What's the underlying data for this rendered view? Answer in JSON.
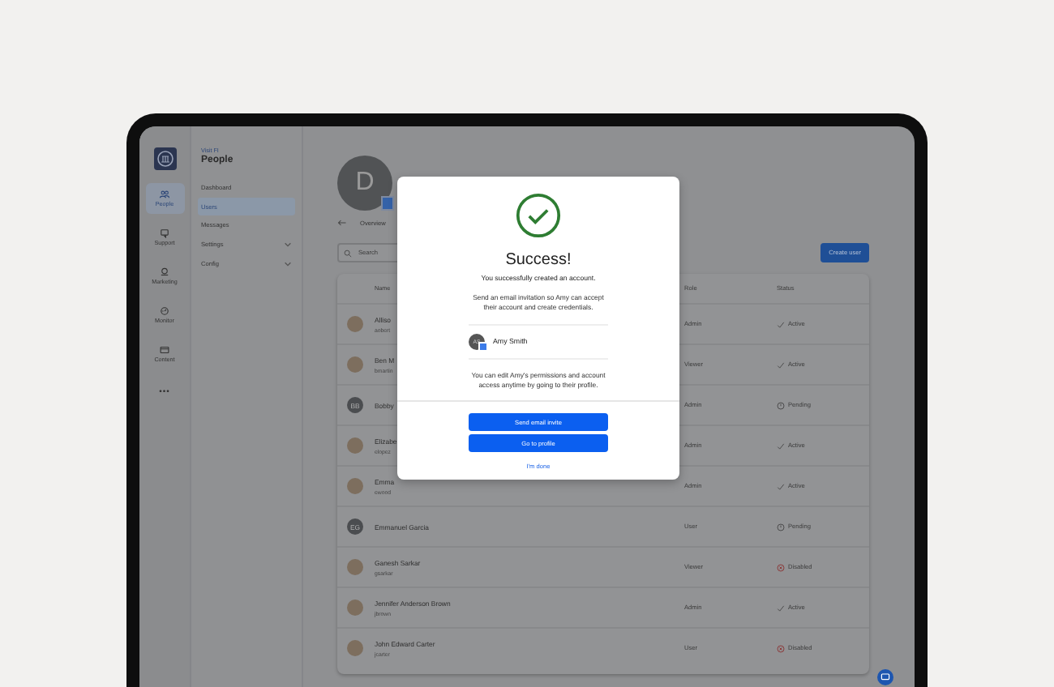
{
  "rail": [
    {
      "label": "People",
      "selected": true,
      "kind": "people"
    },
    {
      "label": "Support",
      "selected": false,
      "kind": "support"
    },
    {
      "label": "Marketing",
      "selected": false,
      "kind": "marketing"
    },
    {
      "label": "Monitor",
      "selected": false,
      "kind": "monitor"
    },
    {
      "label": "Content",
      "selected": false,
      "kind": "content"
    }
  ],
  "rail_more": "•••",
  "sidebar": {
    "eyebrow": "Visit FI",
    "title": "People",
    "items": [
      {
        "label": "Dashboard",
        "selected": false,
        "expandable": false
      },
      {
        "label": "Users",
        "selected": true,
        "expandable": false
      },
      {
        "label": "Messages",
        "selected": false,
        "expandable": false
      },
      {
        "label": "Settings",
        "selected": false,
        "expandable": true
      },
      {
        "label": "Config",
        "selected": false,
        "expandable": true
      }
    ]
  },
  "profile": {
    "initial": "D"
  },
  "breadcrumb": "Overview",
  "search": {
    "placeholder": "Search"
  },
  "create_button": "Create user",
  "table": {
    "columns": [
      "Name",
      "Role",
      "Status"
    ],
    "rows": [
      {
        "name": "Alliso",
        "handle": "aobert",
        "avatar": {
          "kind": "photo"
        },
        "role": "Admin",
        "status": "Active",
        "kind": "active"
      },
      {
        "name": "Ben M",
        "handle": "bmartin",
        "avatar": {
          "kind": "photo"
        },
        "role": "Viewer",
        "status": "Active",
        "kind": "active"
      },
      {
        "name": "Bobby",
        "avatar": {
          "kind": "initials",
          "initials": "BB"
        },
        "role": "Admin",
        "status": "Pending",
        "kind": "pending"
      },
      {
        "name": "Elizabe",
        "handle": "elopez",
        "avatar": {
          "kind": "photo"
        },
        "role": "Admin",
        "status": "Active",
        "kind": "active"
      },
      {
        "name": "Emma",
        "handle": "ewood",
        "avatar": {
          "kind": "photo"
        },
        "role": "Admin",
        "status": "Active",
        "kind": "active"
      },
      {
        "name": "Emmanuel Garcia",
        "avatar": {
          "kind": "initials",
          "initials": "EG"
        },
        "role": "User",
        "status": "Pending",
        "kind": "pending"
      },
      {
        "name": "Ganesh Sarkar",
        "handle": "gsarkar",
        "avatar": {
          "kind": "photo"
        },
        "role": "Viewer",
        "status": "Disabled",
        "kind": "disabled"
      },
      {
        "name": "Jennifer Anderson Brown",
        "handle": "jbrown",
        "avatar": {
          "kind": "photo"
        },
        "role": "Admin",
        "status": "Active",
        "kind": "active"
      },
      {
        "name": "John Edward Carter",
        "handle": "jcarter",
        "avatar": {
          "kind": "photo"
        },
        "role": "User",
        "status": "Disabled",
        "kind": "disabled"
      }
    ]
  },
  "dialog": {
    "title": "Success!",
    "subtitle": "You successfully created an account.",
    "invite_text": "Send an email invitation so Amy can accept their account and create credentials.",
    "user": {
      "initials": "AS",
      "name": "Amy Smith"
    },
    "note": "You can edit Amy's permissions and account access anytime by going to their profile.",
    "buttons": [
      "Send email invite",
      "Go to profile"
    ],
    "link": "I'm done"
  }
}
